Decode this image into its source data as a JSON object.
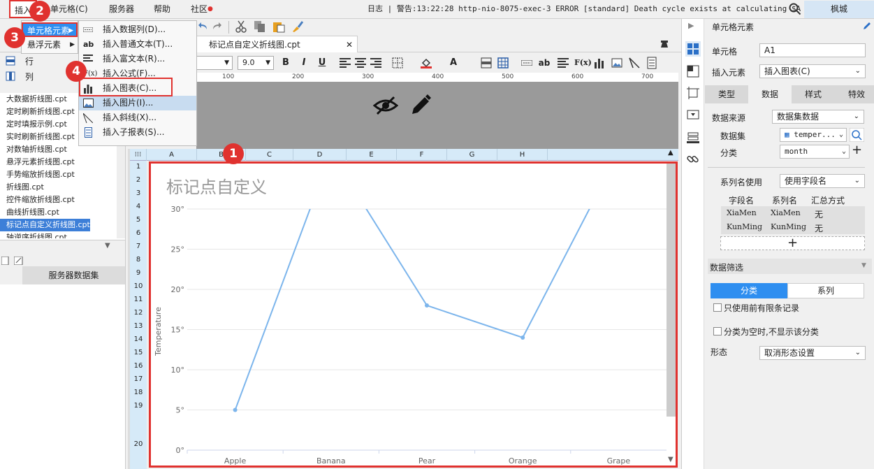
{
  "menubar": {
    "items": [
      {
        "label": "插入",
        "x_hint": "insert"
      },
      {
        "label": "单元格(C)"
      },
      {
        "label": "服务器"
      },
      {
        "label": "帮助"
      },
      {
        "label": "社区"
      }
    ],
    "log_text": "日志 | 警告:13:22:28 http-nio-8075-exec-3 ERROR [standard] Death cycle exists at calculating $A",
    "user": "枫城"
  },
  "tab": {
    "title": "标记点自定义折线图.cpt"
  },
  "format": {
    "size": "9.0"
  },
  "ruler": [
    "100",
    "200",
    "300",
    "400",
    "500",
    "600",
    "700"
  ],
  "menu1": {
    "items": [
      "单元格元素",
      "悬浮元素"
    ]
  },
  "menu2": {
    "items": [
      "插入数据列(D)...",
      "插入普通文本(T)...",
      "插入富文本(R)...",
      "插入公式(F)...",
      "插入图表(C)...",
      "插入图片(I)...",
      "插入斜线(X)...",
      "插入子报表(S)..."
    ]
  },
  "leftpanel": {
    "rows": [
      "行",
      "列"
    ],
    "files": [
      "大数据折线图.cpt",
      "定时刷新折线图.cpt",
      "定时填报示例.cpt",
      "实时刷新折线图.cpt",
      "对数轴折线图.cpt",
      "悬浮元素折线图.cpt",
      "手势缩放折线图.cpt",
      "折线图.cpt",
      "控件缩放折线图.cpt",
      "曲线折线图.cpt",
      "标记点自定义折线图.cpt",
      "轴逆序折线图.cpt"
    ],
    "server_dataset": "服务器数据集"
  },
  "columns": [
    "A",
    "B",
    "C",
    "D",
    "E",
    "F",
    "G",
    "H"
  ],
  "rows": [
    "1",
    "2",
    "3",
    "4",
    "5",
    "6",
    "7",
    "8",
    "9",
    "10",
    "11",
    "12",
    "13",
    "14",
    "15",
    "16",
    "17",
    "18",
    "19",
    "20"
  ],
  "badges": [
    "1",
    "2",
    "3",
    "4"
  ],
  "chart_data": {
    "type": "line",
    "title": "标记点自定义",
    "ylabel": "Temperature",
    "categories": [
      "Apple",
      "Banana",
      "Pear",
      "Orange",
      "Grape"
    ],
    "ytick_labels": [
      "0°",
      "5°",
      "10°",
      "15°",
      "20°",
      "25°",
      "30°"
    ],
    "ylim": [
      0,
      30
    ],
    "series": [
      {
        "values": [
          5,
          37,
          18,
          14,
          37
        ]
      }
    ],
    "grid": true,
    "line_color": "#7cb5ec"
  },
  "right": {
    "header": "单元格元素",
    "cell_label": "单元格",
    "cell_value": "A1",
    "insert_label": "插入元素",
    "insert_value": "插入图表(C)",
    "subtabs": [
      "类型",
      "数据",
      "样式",
      "特效"
    ],
    "source_label": "数据来源",
    "source_value": "数据集数据",
    "dataset_label": "数据集",
    "dataset_value": "temper...",
    "category_label": "分类",
    "category_value": "month",
    "series_use_label": "系列名使用",
    "series_use_value": "使用字段名",
    "table_headers": [
      "字段名",
      "系列名",
      "汇总方式"
    ],
    "table_rows": [
      [
        "XiaMen",
        "XiaMen",
        "无"
      ],
      [
        "KunMing",
        "KunMing",
        "无"
      ]
    ],
    "add": "+",
    "filter_label": "数据筛选",
    "filter_tabs": [
      "分类",
      "系列"
    ],
    "check1": "只使用前有限条记录",
    "check2": "分类为空时,不显示该分类",
    "shape_label": "形态",
    "shape_value": "取消形态设置"
  }
}
